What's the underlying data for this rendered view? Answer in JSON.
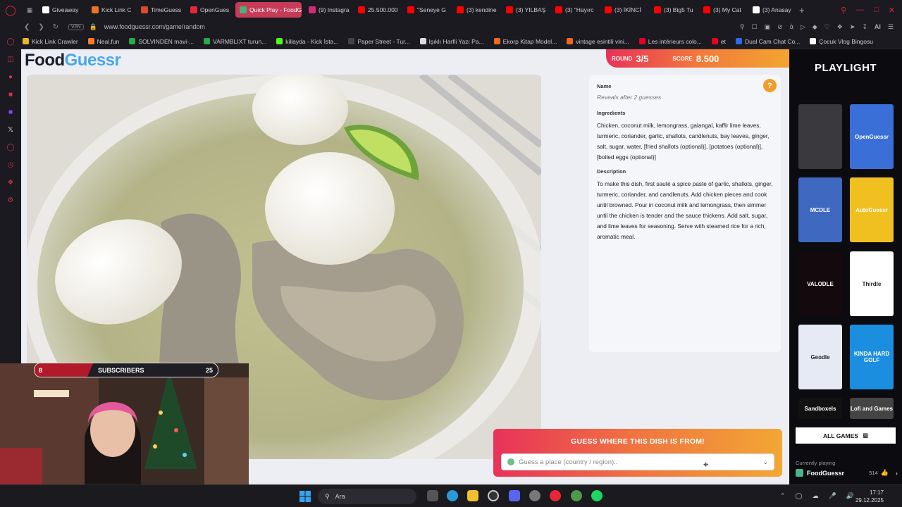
{
  "browser": {
    "tabs": [
      {
        "label": "Giveaway",
        "color": "#ffffff"
      },
      {
        "label": "Kick Link C",
        "color": "#e8742a"
      },
      {
        "label": "TimeGuess",
        "color": "#d94b2b"
      },
      {
        "label": "OpenGues",
        "color": "#e8263a"
      },
      {
        "label": "Quick Play - FoodG",
        "color": "#49b07a",
        "active": true
      },
      {
        "label": "(9) Instagra",
        "color": "#d62976"
      },
      {
        "label": "25.500.000",
        "color": "#ff0000"
      },
      {
        "label": "\"Seneye G",
        "color": "#ff0000"
      },
      {
        "label": "(3) kendine",
        "color": "#ff0000"
      },
      {
        "label": "(3) YILBAŞ",
        "color": "#ff0000"
      },
      {
        "label": "(3) \"Hayırc",
        "color": "#ff0000"
      },
      {
        "label": "(3) İKİNCİ",
        "color": "#ff0000"
      },
      {
        "label": "(3) Big5 Tu",
        "color": "#ff0000"
      },
      {
        "label": "(3) My Cat",
        "color": "#ff0000"
      },
      {
        "label": "(3) Anasay",
        "color": "#ffffff"
      }
    ],
    "vpn_label": "VPN",
    "url": "www.foodguessr.com/game/random",
    "ai_label": "AI",
    "bookmarks": [
      {
        "label": "Kick Link Crawler",
        "color": "#e8b62a"
      },
      {
        "label": "Neal.fun",
        "color": "#ff7b2a"
      },
      {
        "label": "SOLVINDEN mavi-...",
        "color": "#2aa84a"
      },
      {
        "label": "VARMBLIXT turun...",
        "color": "#2aa84a"
      },
      {
        "label": "killayda - Kick İsta...",
        "color": "#53fc18"
      },
      {
        "label": "Paper Street - Tur...",
        "color": "#444444"
      },
      {
        "label": "Işıklı Harfli Yazı Pa...",
        "color": "#dddddd"
      },
      {
        "label": "Ekorp Kitap Model...",
        "color": "#ee6a1a"
      },
      {
        "label": "vintage esintili vini...",
        "color": "#ee6a1a"
      },
      {
        "label": "Les intérieurs colo...",
        "color": "#e60023"
      },
      {
        "label": "et",
        "color": "#e60023"
      },
      {
        "label": "Dual Cam Chat Co...",
        "color": "#2a6be8"
      },
      {
        "label": "Çocuk Vlog Bingosu",
        "color": "#ffffff"
      }
    ]
  },
  "game": {
    "brand_food": "Food",
    "brand_guessr": "Guessr",
    "round_label": "ROUND",
    "round_value": "3/5",
    "score_label": "SCORE",
    "score_value": "8.500",
    "name_label": "Name",
    "name_hint": "Reveals after 2 guesses",
    "ingredients_label": "Ingredients",
    "ingredients_text": "Chicken, coconut milk, lemongrass, galangal, kaffir lime leaves, turmeric, coriander, garlic, shallots, candlenuts, bay leaves, ginger, salt, sugar, water, [fried shallots (optional)], [potatoes (optional)], [boiled eggs (optional)]",
    "description_label": "Description",
    "description_text": "To make this dish, first sauté a spice paste of garlic, shallots, ginger, turmeric, coriander, and candlenuts. Add chicken pieces and cook until browned. Pour in coconut milk and lemongrass, then simmer until the chicken is tender and the sauce thickens. Add salt, sugar, and lime leaves for seasoning. Serve with steamed rice for a rich, aromatic meal.",
    "help_icon": "?",
    "guess_title": "GUESS WHERE THIS DISH IS FROM!",
    "guess_placeholder": "Guess a place (country / region).."
  },
  "overlay": {
    "subs_left": "8",
    "subs_label": "SUBSCRIBERS",
    "subs_right": "25",
    "subs_progress": 0.32
  },
  "sidebar": {
    "title": "PLAYLIGHT",
    "games": [
      {
        "label": "",
        "bg": "#3a3a3e"
      },
      {
        "label": "OpenGuessr",
        "bg": "#3a6fd8"
      },
      {
        "label": "MCDLE",
        "bg": "#3f68c0"
      },
      {
        "label": "AutoGuessr",
        "bg": "#f0c020"
      },
      {
        "label": "VALODLE",
        "bg": "#140a0e"
      },
      {
        "label": "Thirdle",
        "bg": "#ffffff"
      },
      {
        "label": "Geodle",
        "bg": "#e6eaf4"
      },
      {
        "label": "KINDA HARD GOLF",
        "bg": "#1b8ee0"
      },
      {
        "label": "Sandboxels",
        "bg": "#111111"
      },
      {
        "label": "Lofi and Games",
        "bg": "#444444"
      }
    ],
    "all_games_label": "ALL GAMES",
    "currently_playing_label": "Currently playing",
    "current_game": "FoodGuessr",
    "likes": "514"
  },
  "taskbar": {
    "search_label": "Ara",
    "time": "17:17",
    "date": "29.12.2025"
  }
}
